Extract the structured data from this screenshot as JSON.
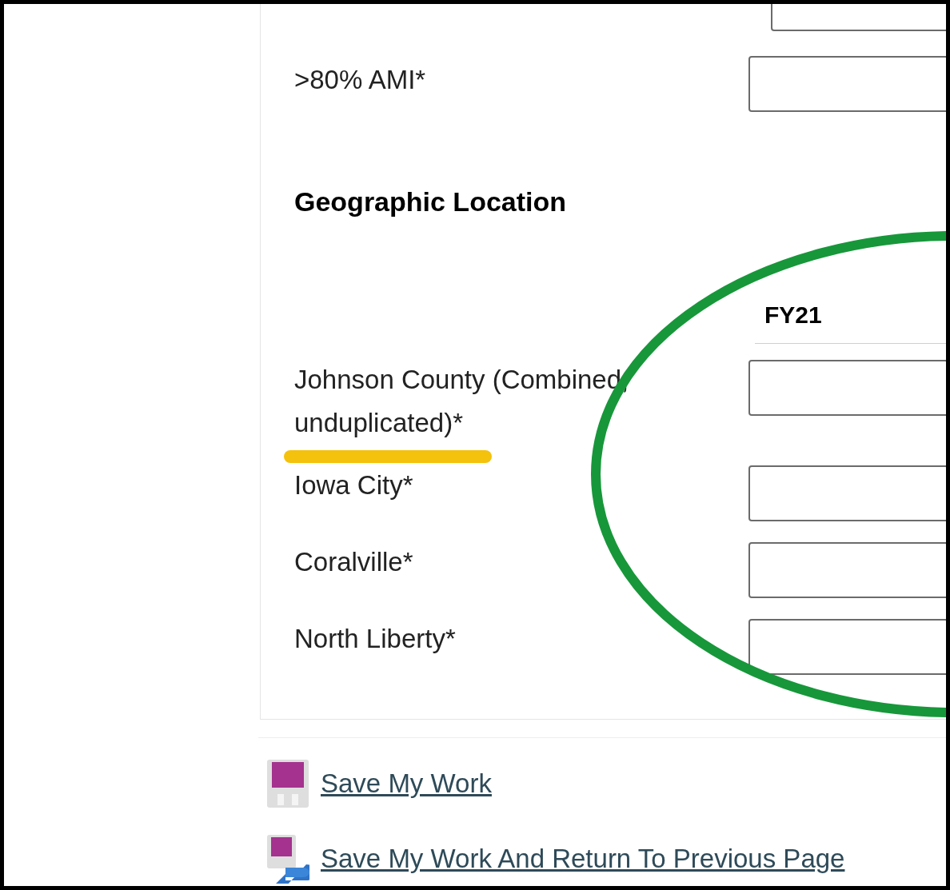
{
  "income_rows": [
    {
      "label": ">80% AMI*"
    }
  ],
  "geographic_location": {
    "title": "Geographic Location",
    "column_header": "FY21",
    "rows": [
      {
        "label": "Johnson County (Combined, unduplicated)*"
      },
      {
        "label": "Iowa City*"
      },
      {
        "label": "Coralville*"
      },
      {
        "label": "North Liberty*"
      }
    ]
  },
  "links": [
    {
      "kind": "save",
      "label": "Save My Work"
    },
    {
      "kind": "save-return",
      "label": "Save My Work And Return To Previous Page"
    }
  ]
}
